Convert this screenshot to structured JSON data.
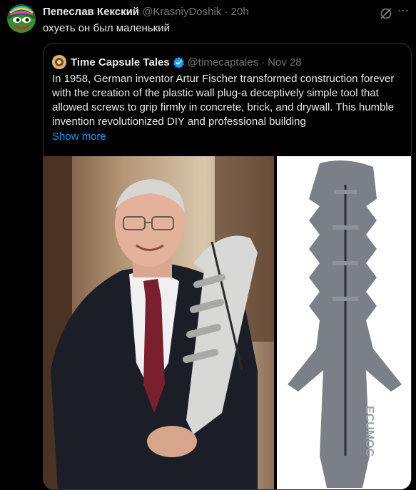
{
  "tweet": {
    "author_name": "Пепеслав Кекский",
    "author_handle": "@KrasniyDoshik",
    "separator": "·",
    "time": "20h",
    "text": "охуеть он был маленький",
    "more_icon": "more-dots-icon",
    "grok_icon": "grok-icon"
  },
  "quoted": {
    "author_name": "Time Capsule Tales",
    "author_handle": "@timecaptales",
    "separator": "·",
    "date": "Nov 28",
    "body": "In 1958, German inventor Artur Fischer transformed construction forever with the creation of the plastic wall plug-a deceptively simple tool that allowed screws to grip firmly in concrete, brick, and drywall. This humble invention revolutionized DIY and professional building",
    "show_more": "Show more",
    "plug_brand": "ECUMOC",
    "colors": {
      "link": "#1d9bf0",
      "verified": "#1d9bf0"
    }
  }
}
